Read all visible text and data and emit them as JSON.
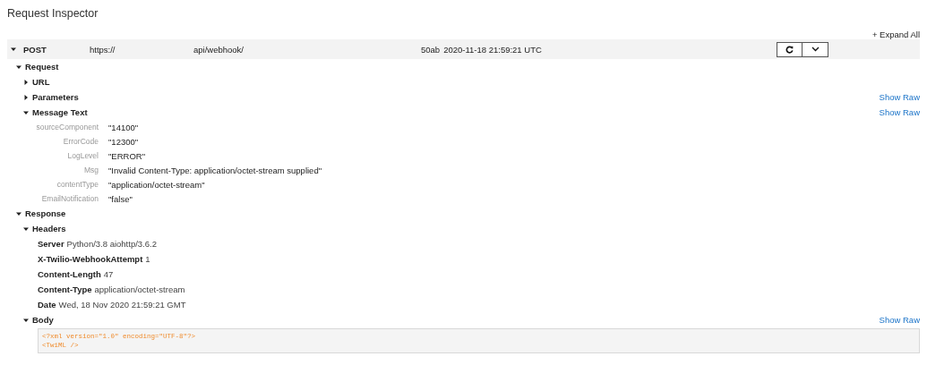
{
  "title": "Request Inspector",
  "expand_all": "+ Expand All",
  "request": {
    "method": "POST",
    "expanded": true,
    "url_scheme": "https://",
    "url_path": "api/webhook/",
    "sid": "50ab",
    "time": "2020-11-18 21:59:21 UTC"
  },
  "tree": [
    {
      "kind": "group",
      "label": "Request",
      "expanded": true,
      "children": [
        {
          "label": "URL",
          "expanded": false
        },
        {
          "label": "Parameters",
          "expanded": false,
          "show_raw": "Show Raw"
        },
        {
          "kind": "params",
          "label": "Message Text",
          "expanded": true,
          "show_raw": "Show Raw",
          "params": [
            {
              "key": "sourceComponent",
              "value": "\"14100\""
            },
            {
              "key": "ErrorCode",
              "value": "\"12300\""
            },
            {
              "key": "LogLevel",
              "value": "\"ERROR\""
            },
            {
              "key": "Msg",
              "value": "\"Invalid Content-Type: application/octet-stream supplied\""
            },
            {
              "key": "contentType",
              "value": "\"application/octet-stream\""
            },
            {
              "key": "EmailNotification",
              "value": "\"false\""
            }
          ]
        }
      ]
    },
    {
      "kind": "group",
      "label": "Response",
      "expanded": true,
      "children": [
        {
          "kind": "headers",
          "label": "Headers",
          "expanded": true,
          "headers": [
            {
              "key": "Server",
              "value": "Python/3.8 aiohttp/3.6.2"
            },
            {
              "key": "X-Twilio-WebhookAttempt",
              "value": "1"
            },
            {
              "key": "Content-Length",
              "value": "47"
            },
            {
              "key": "Content-Type",
              "value": "application/octet-stream"
            },
            {
              "key": "Date",
              "value": "Wed, 18 Nov 2020 21:59:21 GMT"
            }
          ]
        },
        {
          "kind": "code",
          "label": "Body",
          "expanded": true,
          "show_raw": "Show Raw",
          "lines": [
            "<?xml version=\"1.0\" encoding=\"UTF-8\"?>",
            "<TwiML />"
          ]
        }
      ]
    }
  ]
}
